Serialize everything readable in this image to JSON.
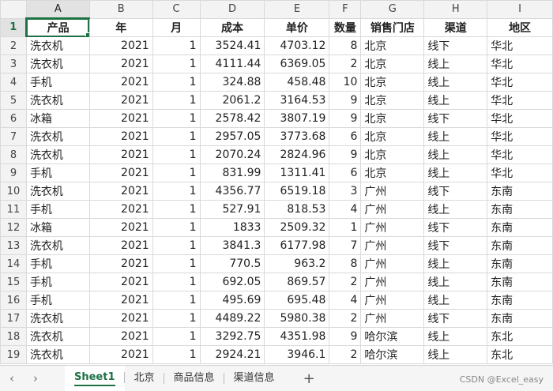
{
  "columns": [
    "A",
    "B",
    "C",
    "D",
    "E",
    "F",
    "G",
    "H",
    "I"
  ],
  "header": [
    "产品",
    "年",
    "月",
    "成本",
    "单价",
    "数量",
    "销售门店",
    "渠道",
    "地区"
  ],
  "rows": [
    {
      "n": "2",
      "c": [
        "洗衣机",
        "2021",
        "1",
        "3524.41",
        "4703.12",
        "8",
        "北京",
        "线下",
        "华北"
      ]
    },
    {
      "n": "3",
      "c": [
        "洗衣机",
        "2021",
        "1",
        "4111.44",
        "6369.05",
        "2",
        "北京",
        "线上",
        "华北"
      ]
    },
    {
      "n": "4",
      "c": [
        "手机",
        "2021",
        "1",
        "324.88",
        "458.48",
        "10",
        "北京",
        "线上",
        "华北"
      ]
    },
    {
      "n": "5",
      "c": [
        "洗衣机",
        "2021",
        "1",
        "2061.2",
        "3164.53",
        "9",
        "北京",
        "线上",
        "华北"
      ]
    },
    {
      "n": "6",
      "c": [
        "冰箱",
        "2021",
        "1",
        "2578.42",
        "3807.19",
        "9",
        "北京",
        "线下",
        "华北"
      ]
    },
    {
      "n": "7",
      "c": [
        "洗衣机",
        "2021",
        "1",
        "2957.05",
        "3773.68",
        "6",
        "北京",
        "线上",
        "华北"
      ]
    },
    {
      "n": "8",
      "c": [
        "洗衣机",
        "2021",
        "1",
        "2070.24",
        "2824.96",
        "9",
        "北京",
        "线上",
        "华北"
      ]
    },
    {
      "n": "9",
      "c": [
        "手机",
        "2021",
        "1",
        "831.99",
        "1311.41",
        "6",
        "北京",
        "线上",
        "华北"
      ]
    },
    {
      "n": "10",
      "c": [
        "洗衣机",
        "2021",
        "1",
        "4356.77",
        "6519.18",
        "3",
        "广州",
        "线下",
        "东南"
      ]
    },
    {
      "n": "11",
      "c": [
        "手机",
        "2021",
        "1",
        "527.91",
        "818.53",
        "4",
        "广州",
        "线上",
        "东南"
      ]
    },
    {
      "n": "12",
      "c": [
        "冰箱",
        "2021",
        "1",
        "1833",
        "2509.32",
        "1",
        "广州",
        "线下",
        "东南"
      ]
    },
    {
      "n": "13",
      "c": [
        "洗衣机",
        "2021",
        "1",
        "3841.3",
        "6177.98",
        "7",
        "广州",
        "线下",
        "东南"
      ]
    },
    {
      "n": "14",
      "c": [
        "手机",
        "2021",
        "1",
        "770.5",
        "963.2",
        "8",
        "广州",
        "线上",
        "东南"
      ]
    },
    {
      "n": "15",
      "c": [
        "手机",
        "2021",
        "1",
        "692.05",
        "869.57",
        "2",
        "广州",
        "线上",
        "东南"
      ]
    },
    {
      "n": "16",
      "c": [
        "手机",
        "2021",
        "1",
        "495.69",
        "695.48",
        "4",
        "广州",
        "线上",
        "东南"
      ]
    },
    {
      "n": "17",
      "c": [
        "洗衣机",
        "2021",
        "1",
        "4489.22",
        "5980.38",
        "2",
        "广州",
        "线下",
        "东南"
      ]
    },
    {
      "n": "18",
      "c": [
        "洗衣机",
        "2021",
        "1",
        "3292.75",
        "4351.98",
        "9",
        "哈尔滨",
        "线上",
        "东北"
      ]
    },
    {
      "n": "19",
      "c": [
        "洗衣机",
        "2021",
        "1",
        "2924.21",
        "3946.1",
        "2",
        "哈尔滨",
        "线上",
        "东北"
      ]
    }
  ],
  "header_row_number": "1",
  "tabs": [
    "Sheet1",
    "北京",
    "商品信息",
    "渠道信息"
  ],
  "active_tab": "Sheet1",
  "nav": {
    "prev": "‹",
    "next": "›",
    "add": "+"
  },
  "watermark": "CSDN @Excel_easy",
  "colors": {
    "accent": "#1e7145",
    "header_bg": "#f3f3f3",
    "grid": "#d9d9d9"
  }
}
